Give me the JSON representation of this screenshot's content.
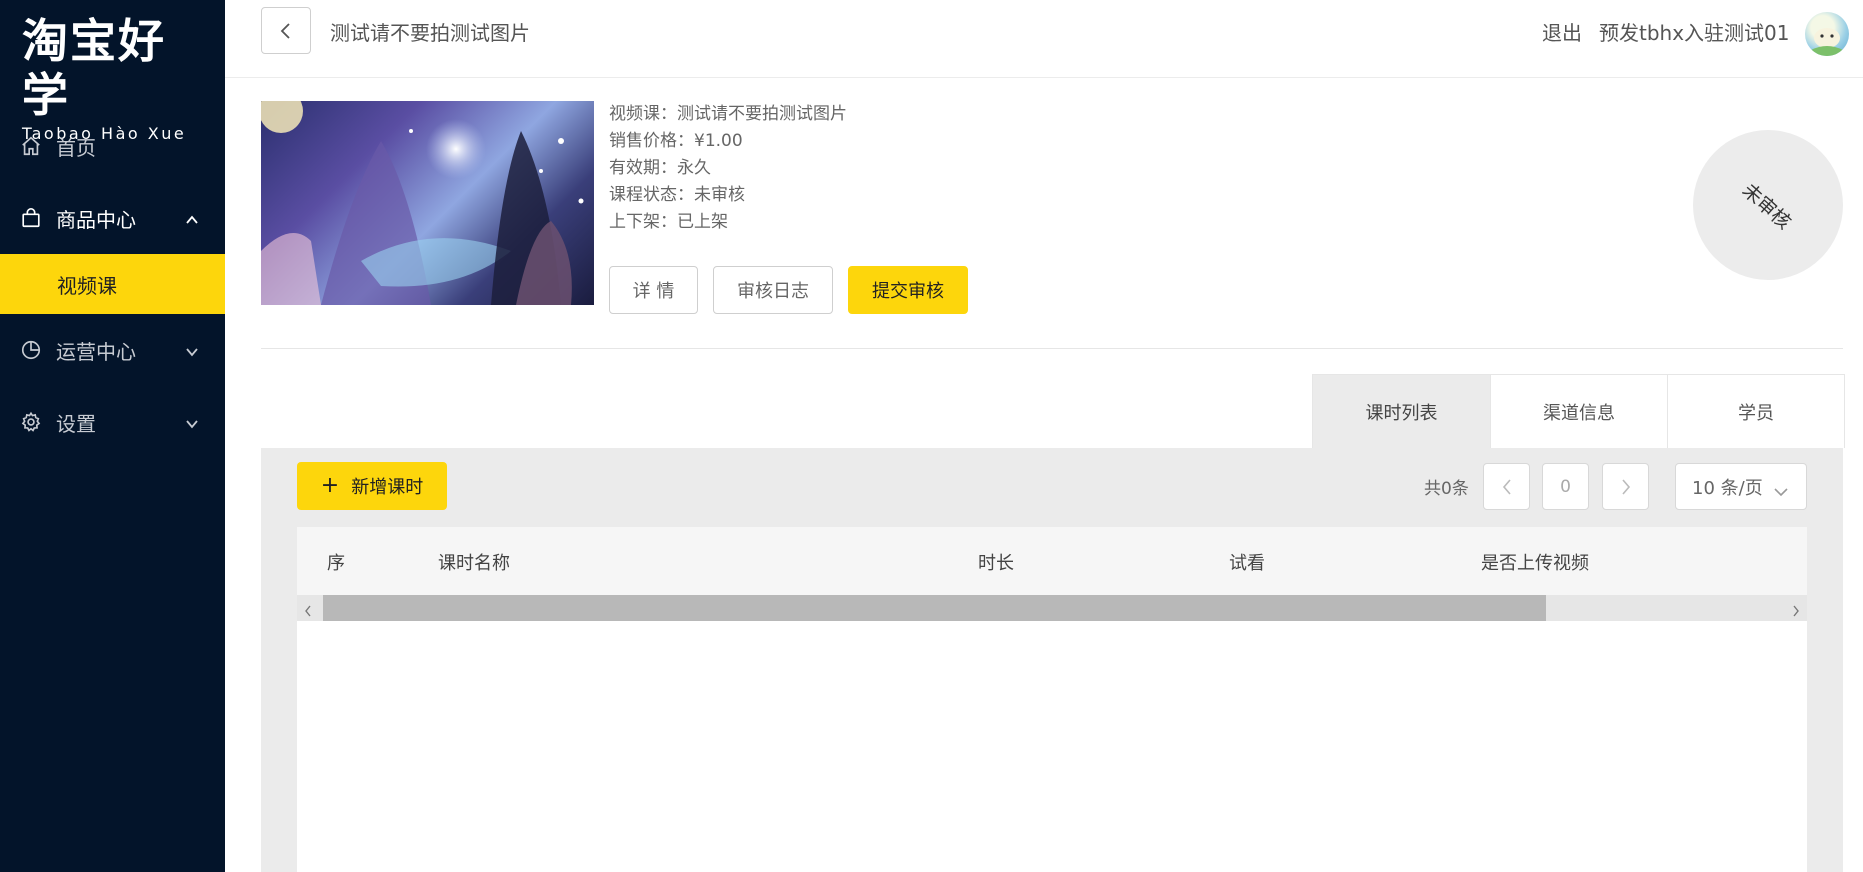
{
  "sidebar": {
    "logo_cn": "淘宝好学",
    "logo_en": "Taobao Hào Xue",
    "items": [
      {
        "label": "首页",
        "icon": "home-icon"
      },
      {
        "label": "商品中心",
        "icon": "shopping-bag-icon",
        "expanded": true,
        "children": [
          {
            "label": "视频课",
            "active": true
          }
        ]
      },
      {
        "label": "运营中心",
        "icon": "pie-chart-icon"
      },
      {
        "label": "设置",
        "icon": "gear-icon"
      }
    ]
  },
  "header": {
    "title": "测试请不要拍测试图片",
    "logout": "退出",
    "username": "预发tbhx入驻测试01"
  },
  "course": {
    "type_line": "视频课：测试请不要拍测试图片",
    "price_line": "销售价格：¥1.00",
    "validity_line": "有效期：永久",
    "status_line": "课程状态：未审核",
    "shelf_line": "上下架：已上架",
    "buttons": {
      "detail": "详 情",
      "audit_log": "审核日志",
      "submit": "提交审核"
    },
    "stamp": "未审核"
  },
  "tabs": [
    {
      "label": "课时列表",
      "active": true
    },
    {
      "label": "渠道信息"
    },
    {
      "label": "学员"
    }
  ],
  "toolbar": {
    "add_label": "新增课时",
    "total": "共0条",
    "current_page": "0",
    "page_size": "10 条/页"
  },
  "table": {
    "columns": [
      "序",
      "课时名称",
      "时长",
      "试看",
      "是否上传视频"
    ],
    "rows": []
  },
  "colors": {
    "sidebar_bg": "#03142a",
    "accent": "#fdd60c"
  }
}
